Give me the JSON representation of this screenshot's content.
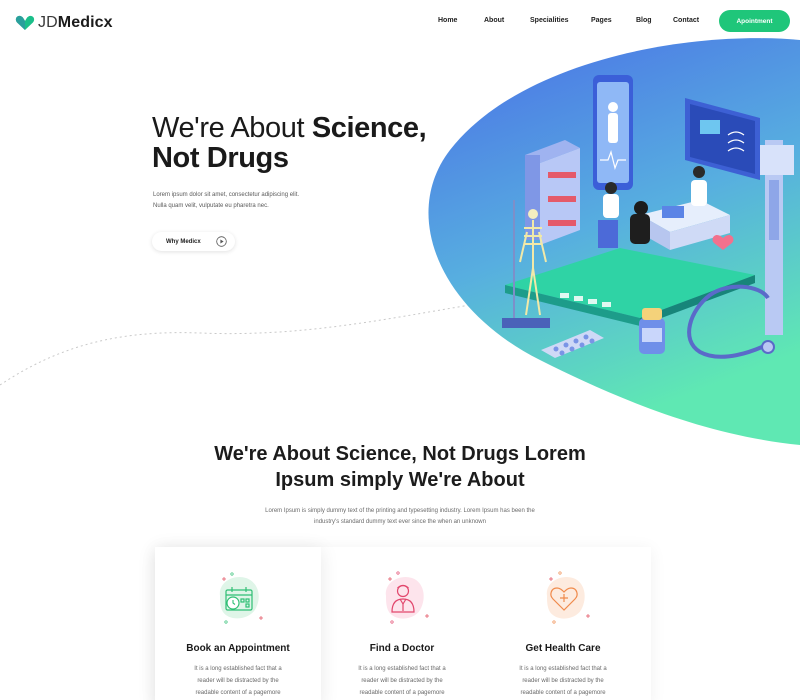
{
  "brand": {
    "light": "JD",
    "bold": "Medicx"
  },
  "nav": [
    {
      "label": "Home",
      "key": "home"
    },
    {
      "label": "About",
      "key": "about"
    },
    {
      "label": "Specialities",
      "key": "specialities"
    },
    {
      "label": "Pages",
      "key": "pages"
    },
    {
      "label": "Blog",
      "key": "blog"
    },
    {
      "label": "Contact",
      "key": "contact"
    }
  ],
  "header": {
    "cta_label": "Apointment"
  },
  "hero": {
    "title_light_1": "We're About ",
    "title_bold_1": "Science,",
    "title_bold_2": "Not Drugs",
    "desc_lines": [
      "Lorem ipsum dolor sit amet, consectetur adipiscing elit.",
      "Nulla quam velit, vulputate eu pharetra nec."
    ],
    "button_label": "Why Medicx"
  },
  "section": {
    "title_lines": [
      "We're About Science, Not Drugs Lorem",
      "Ipsum simply We're About"
    ],
    "desc_lines": [
      "Lorem Ipsum is simply dummy text of the printing and typesetting industry. Lorem Ipsum has been the",
      "industry's standard dummy text ever since the when an unknown"
    ]
  },
  "cards": [
    {
      "title": "Book an Appointment",
      "icon": "calendar-clock-icon",
      "blob_color": "#dff5e8",
      "icon_color": "#2fbf74",
      "lines": [
        "It is a long established fact that a",
        "reader will be distracted by the",
        "readable content of a pagemore"
      ]
    },
    {
      "title": "Find a Doctor",
      "icon": "doctor-icon",
      "blob_color": "#fde4ec",
      "icon_color": "#e2476d",
      "lines": [
        "It is a long established fact that a",
        "reader will be distracted by the",
        "readable content of a pagemore"
      ]
    },
    {
      "title": "Get Health Care",
      "icon": "heart-care-icon",
      "blob_color": "#fdebdf",
      "icon_color": "#f08a4b",
      "lines": [
        "It is a long established fact that a",
        "reader will be distracted by the",
        "readable content of a pagemore"
      ]
    }
  ],
  "colors": {
    "accent_green": "#1fc67a",
    "hero_gradient_top": "#4a6ee6",
    "hero_gradient_bottom": "#5fe8b3",
    "text_dark": "#1a1a1a"
  }
}
